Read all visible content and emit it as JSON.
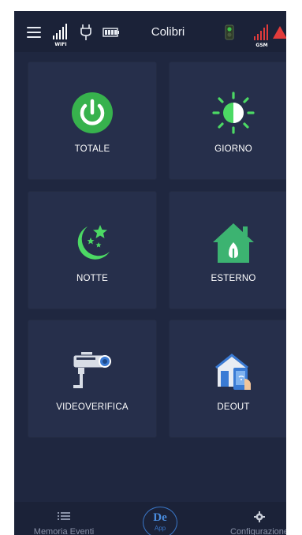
{
  "header": {
    "title": "Colibri",
    "wifi_label": "WIFI",
    "gsm_label": "GSM",
    "icons": [
      "menu-icon",
      "wifi-signal-icon",
      "power-plug-icon",
      "battery-icon",
      "green-led-icon",
      "gsm-signal-icon",
      "alarm-triangle-icon"
    ],
    "colors": {
      "background": "#1b2238",
      "alarm": "#e23b3b",
      "led": "#3cc24a"
    }
  },
  "tiles": [
    {
      "label": "TOTALE",
      "icon": "power-button-icon",
      "color": "#37b24d"
    },
    {
      "label": "GIORNO",
      "icon": "sun-icon",
      "color": "#4cd964"
    },
    {
      "label": "NOTTE",
      "icon": "moon-stars-icon",
      "color": "#4cd964"
    },
    {
      "label": "ESTERNO",
      "icon": "house-icon",
      "color": "#3cb371"
    },
    {
      "label": "VIDEOVERIFICA",
      "icon": "security-camera-icon",
      "color": "#3a7bd5"
    },
    {
      "label": "DEOUT",
      "icon": "smart-home-phone-icon",
      "color": "#3a7bd5"
    }
  ],
  "bottom_nav": {
    "events_label": "Memoria Eventi",
    "config_label": "Configurazione",
    "logo_text": "De",
    "logo_sub": "App"
  }
}
